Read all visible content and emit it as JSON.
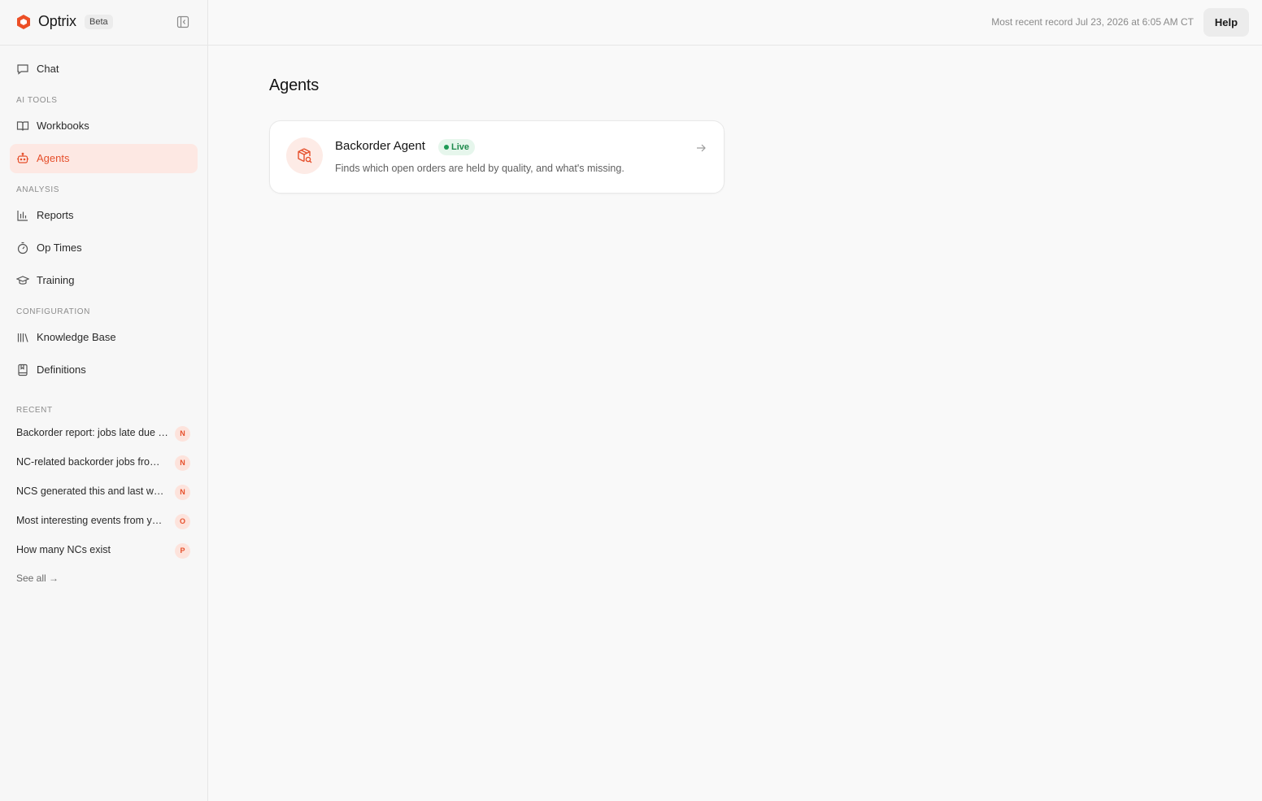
{
  "brand": {
    "name": "Optrix",
    "badge": "Beta"
  },
  "nav": {
    "chat": "Chat",
    "section_ai_tools": "AI TOOLS",
    "workbooks": "Workbooks",
    "agents": "Agents",
    "section_analysis": "ANALYSIS",
    "reports": "Reports",
    "op_times": "Op Times",
    "training": "Training",
    "section_configuration": "CONFIGURATION",
    "knowledge_base": "Knowledge Base",
    "definitions": "Definitions"
  },
  "recent": {
    "label": "RECENT",
    "items": [
      {
        "title": "Backorder report: jobs late due …",
        "initial": "N"
      },
      {
        "title": "NC-related backorder jobs fro…",
        "initial": "N"
      },
      {
        "title": "NCS generated this and last w…",
        "initial": "N"
      },
      {
        "title": "Most interesting events from y…",
        "initial": "O"
      },
      {
        "title": "How many NCs exist",
        "initial": "P"
      }
    ],
    "see_all": "See all →"
  },
  "topbar": {
    "record_text": "Most recent record Jul 23, 2026 at 6:05 AM CT",
    "help_label": "Help"
  },
  "main": {
    "title": "Agents",
    "agents": [
      {
        "name": "Backorder Agent",
        "status": "Live",
        "description": "Finds which open orders are held by quality, and what's missing.",
        "icon": "package-search-icon"
      }
    ]
  },
  "colors": {
    "accent": "#e6502c",
    "accent_bg": "#fde8e3",
    "live_green": "#1e8a4c"
  }
}
